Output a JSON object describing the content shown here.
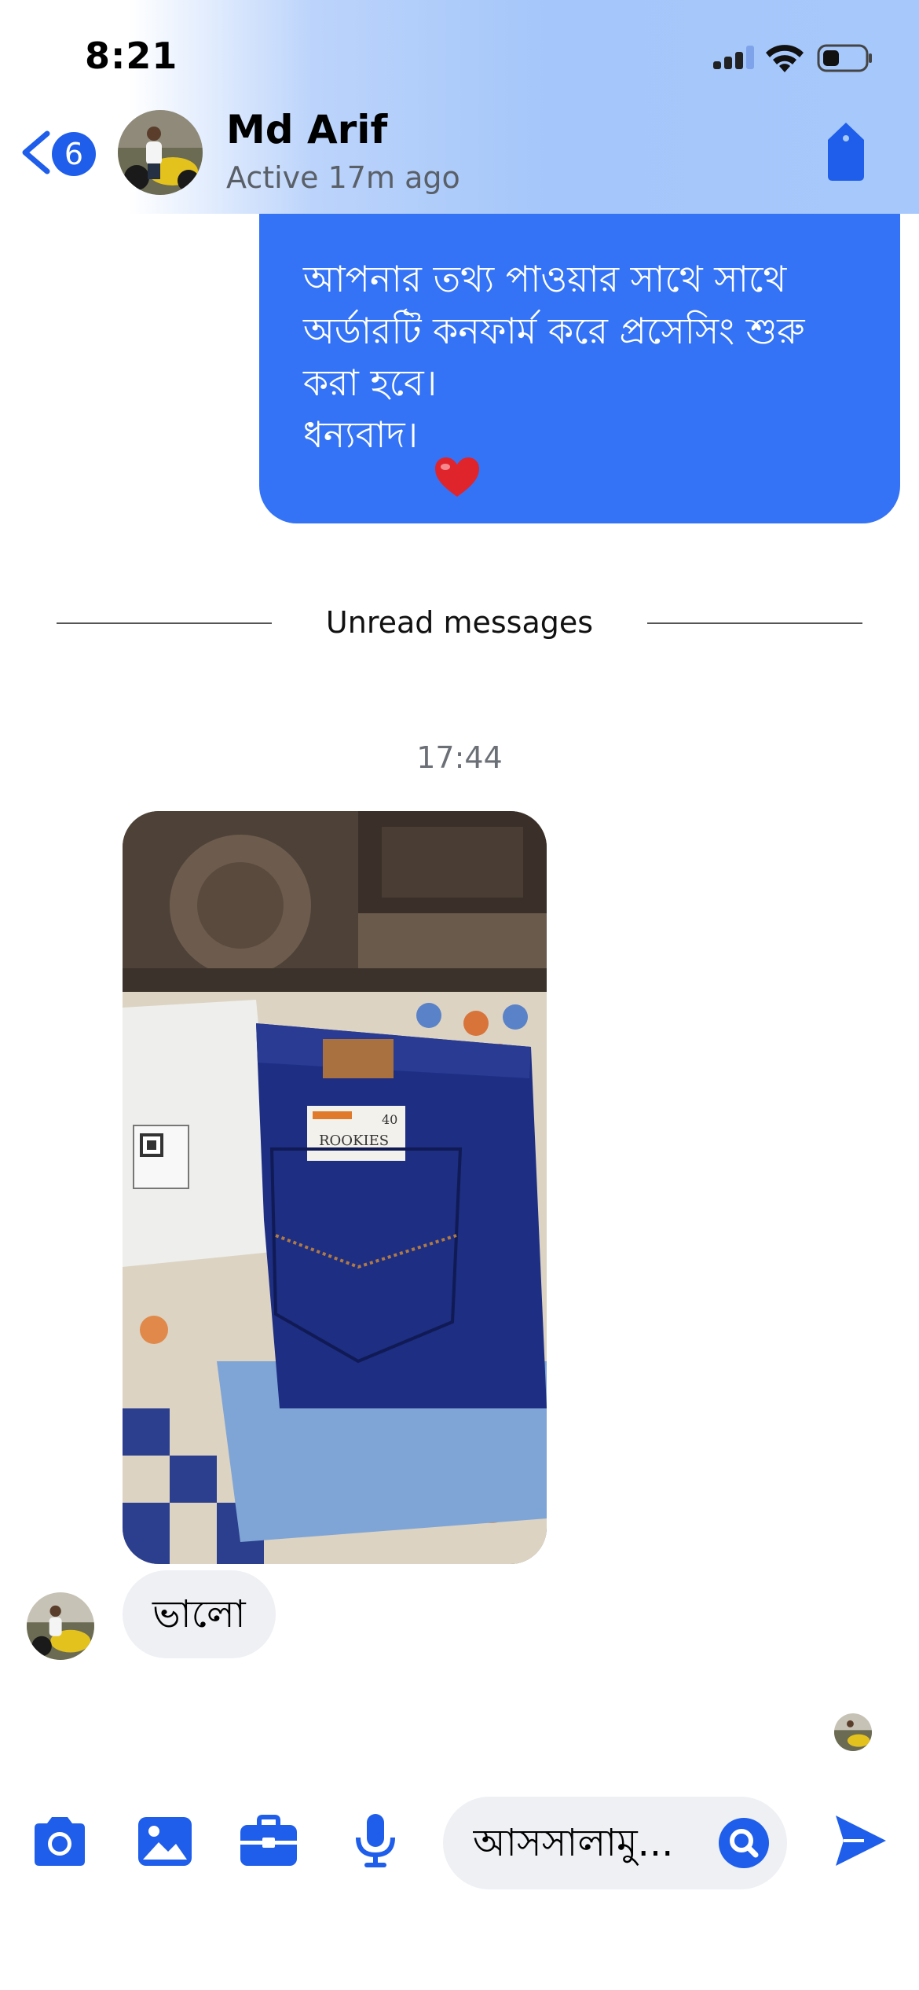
{
  "status_bar": {
    "time": "8:21"
  },
  "header": {
    "back_badge": "6",
    "contact_name": "Md Arif",
    "contact_status": "Active 17m ago"
  },
  "messages": {
    "outgoing": {
      "lines": [
        "আপনার তথ্য পাওয়ার সাথে সাথে",
        "অর্ডারটি কনফার্ম করে প্রসেসিং শুরু",
        "করা হবে।",
        "",
        "ধন্যবাদ।"
      ],
      "emoji": "heart"
    },
    "divider_label": "Unread messages",
    "timestamp": "17:44",
    "photo": {
      "description_icon": "photo-of-jeans"
    },
    "incoming_text": "ভালো"
  },
  "composer": {
    "input_value": "আসসালামু...",
    "icons": [
      "camera-icon",
      "image-icon",
      "briefcase-icon",
      "microphone-icon",
      "search-icon",
      "send-icon"
    ]
  },
  "colors": {
    "accent": "#1e5eea",
    "outgoing_bubble": "#3473f5",
    "incoming_bubble": "#eef0f4"
  }
}
